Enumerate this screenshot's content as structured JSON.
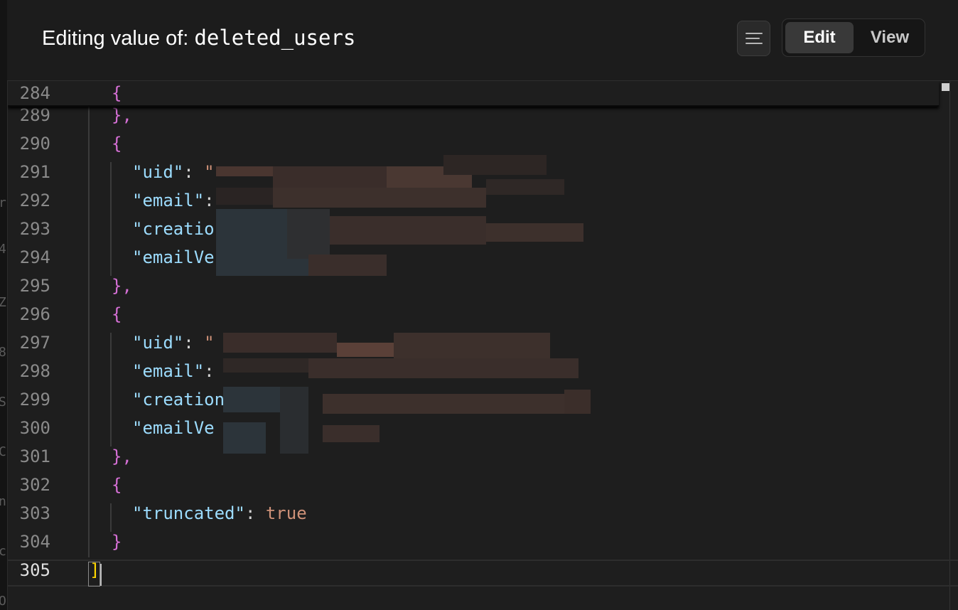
{
  "header": {
    "title_prefix": "Editing value of:",
    "title_key": "deleted_users",
    "format_icon": "align-lines-icon",
    "mode_tabs": [
      {
        "label": "Edit",
        "active": true
      },
      {
        "label": "View",
        "active": false
      }
    ]
  },
  "editor": {
    "sticky_line": {
      "number": "284",
      "text": "{"
    },
    "lines": [
      {
        "number": "289",
        "text": "},"
      },
      {
        "number": "290",
        "text": "{"
      },
      {
        "number": "291",
        "key": "\"uid\"",
        "sep": ": ",
        "value_visible": "\""
      },
      {
        "number": "292",
        "key": "\"email\"",
        "sep": ":",
        "value_visible": ""
      },
      {
        "number": "293",
        "key": "\"creatio",
        "sep": "",
        "value_visible": ""
      },
      {
        "number": "294",
        "key": "\"emailVe",
        "sep": "",
        "value_visible": ""
      },
      {
        "number": "295",
        "text": "},"
      },
      {
        "number": "296",
        "text": "{"
      },
      {
        "number": "297",
        "key": "\"uid\"",
        "sep": ": ",
        "value_visible": "\""
      },
      {
        "number": "298",
        "key": "\"email\"",
        "sep": ":",
        "value_visible": ""
      },
      {
        "number": "299",
        "key": "\"creation",
        "sep": "",
        "value_visible": ""
      },
      {
        "number": "300",
        "key": "\"emailVe",
        "sep": "",
        "value_visible": ""
      },
      {
        "number": "301",
        "text": "},"
      },
      {
        "number": "302",
        "text": "{"
      },
      {
        "number": "303",
        "key": "\"truncated\"",
        "sep": ": ",
        "value_visible": "true"
      },
      {
        "number": "304",
        "text": "}"
      },
      {
        "number": "305",
        "text": "]"
      }
    ],
    "current_line": "305"
  },
  "colors": {
    "background": "#1e1e1e",
    "header_bg": "#1c1c1c",
    "bracket_level2": "#d670d6",
    "bracket_level1": "#ffd700",
    "json_key": "#9cdcfe",
    "json_value": "#ce9178"
  }
}
